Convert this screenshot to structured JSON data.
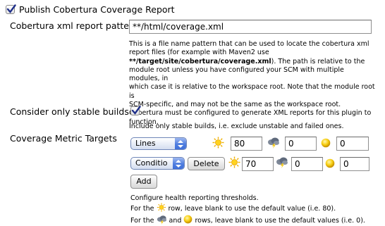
{
  "publish": {
    "label": "Publish Cobertura Coverage Report",
    "checked": true
  },
  "report_pattern": {
    "label": "Cobertura xml report pattern",
    "value": "**/html/coverage.xml",
    "help_lines": [
      "This is a file name pattern that can be used to locate the cobertura xml",
      "report files (for example with Maven2 use",
      "**/target/site/cobertura/coverage.xml). The path is relative to the",
      "module root unless you have configured your SCM with multiple modules, in",
      "which case it is relative to the workspace root. Note that the module root is",
      "SCM-specific, and may not be the same as the workspace root.",
      "Cobertura must be configured to generate XML reports for this plugin to",
      "function."
    ],
    "help_bold": "**/target/site/cobertura/coverage.xml",
    "help_after_bold": "). The path is relative to the"
  },
  "stable_builds": {
    "label": "Consider only stable builds",
    "checked": true,
    "help": "Include only stable builds, i.e. exclude unstable and failed ones."
  },
  "metric_targets": {
    "label": "Coverage Metric Targets",
    "rows": [
      {
        "metric": "Lines",
        "healthy": "80",
        "unhealthy": "0",
        "unstable": "0"
      },
      {
        "metric": "Conditio",
        "delete_label": "Delete",
        "healthy": "70",
        "unhealthy": "0",
        "unstable": "0"
      }
    ],
    "add_label": "Add",
    "help_line1": "Configure health reporting thresholds.",
    "help_line2_pre": "For the",
    "help_line2_post": "row, leave blank to use the default value (i.e. 80).",
    "help_line3_pre": "For the",
    "help_line3_mid": "and",
    "help_line3_post": "rows, leave blank to use the default values (i.e. 0)."
  },
  "colors": {
    "check": "#1f2f8a",
    "select_border": "#6f86b8",
    "sun": "#f5b800"
  },
  "icons": [
    "checkbox-checked-icon",
    "sun-icon",
    "storm-cloud-icon",
    "yellow-ball-icon",
    "select-arrows-icon"
  ]
}
